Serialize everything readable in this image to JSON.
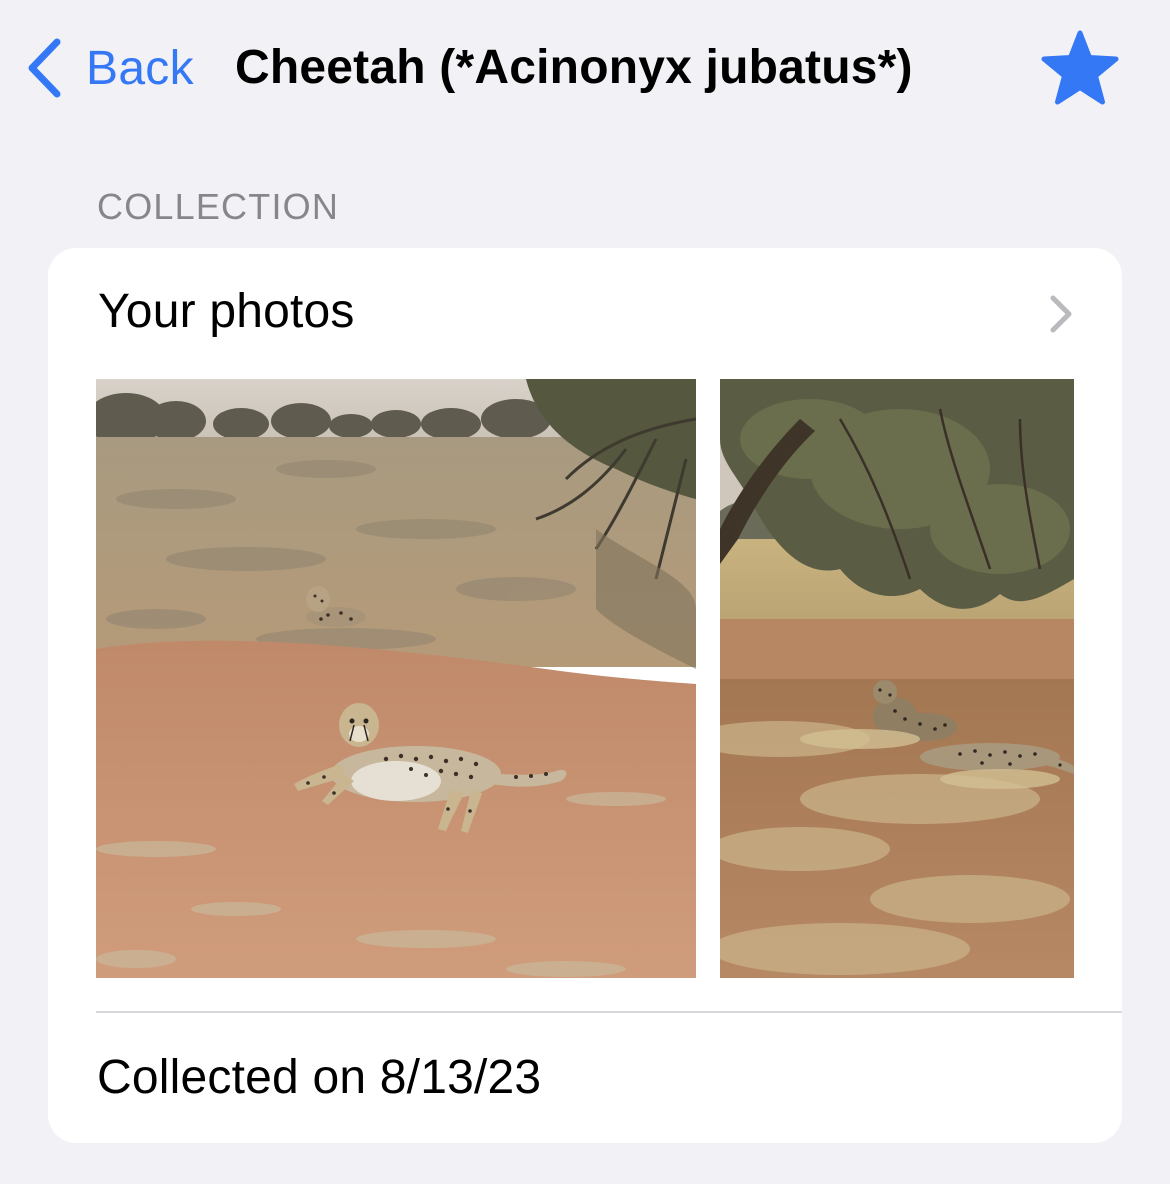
{
  "nav": {
    "back_label": "Back",
    "title": "Cheetah (*Acinonyx jubatus*)",
    "accent_color": "#3478f6",
    "star_icon": "star-filled-icon",
    "back_icon": "chevron-left-icon"
  },
  "collection": {
    "section_header": "COLLECTION",
    "row_label": "Your photos",
    "row_icon": "chevron-right-icon",
    "photos": [
      {
        "subject": "cheetah-photo"
      },
      {
        "subject": "cheetah-photo"
      }
    ],
    "collected_text": "Collected on 8/13/23"
  }
}
